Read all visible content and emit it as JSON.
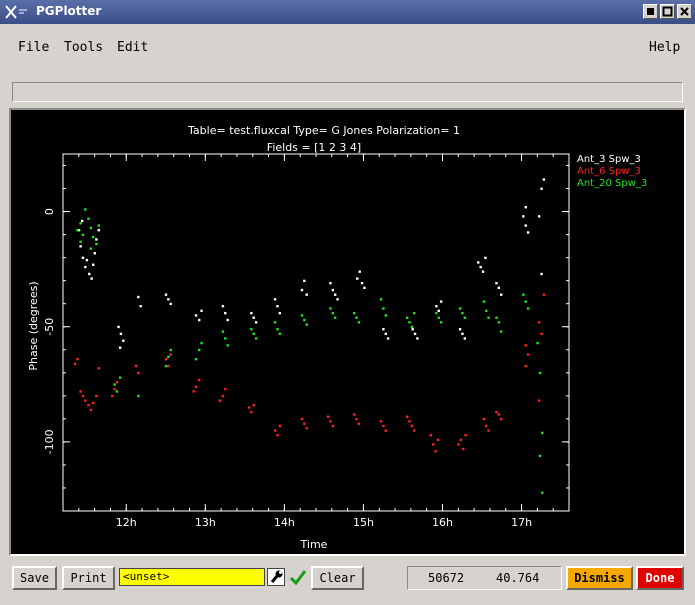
{
  "window": {
    "title": "PGPlotter"
  },
  "menu": {
    "file": "File",
    "tools": "Tools",
    "edit": "Edit",
    "help": "Help"
  },
  "bottom": {
    "save": "Save",
    "print": "Print",
    "entry_value": "<unset>",
    "clear": "Clear",
    "readout_x": "50672",
    "readout_y": "40.764",
    "dismiss": "Dismiss",
    "done": "Done"
  },
  "colors": {
    "background": "#000000",
    "series_1": "#ffffff",
    "series_2": "#ff2020",
    "series_3": "#20e020",
    "dismiss": "#f5a800",
    "done": "#e00000",
    "entry": "#ffff00"
  },
  "chart_data": {
    "type": "scatter",
    "title": "Table= test.fluxcal    Type= G Jones    Polarization= 1",
    "subtitle": "Fields = [1 2 3 4]",
    "xlabel": "Time",
    "ylabel": "Phase (degrees)",
    "xlim": [
      11.2,
      17.6
    ],
    "ylim": [
      -130,
      25
    ],
    "xticks": [
      {
        "value": 12,
        "label": "12h"
      },
      {
        "value": 13,
        "label": "13h"
      },
      {
        "value": 14,
        "label": "14h"
      },
      {
        "value": 15,
        "label": "15h"
      },
      {
        "value": 16,
        "label": "16h"
      },
      {
        "value": 17,
        "label": "17h"
      }
    ],
    "yticks": [
      {
        "value": 0,
        "label": "0"
      },
      {
        "value": -50,
        "label": "-50"
      },
      {
        "value": -100,
        "label": "-100"
      }
    ],
    "legend": "top-right",
    "series": [
      {
        "name": "Ant_3 Spw_3",
        "color": "#ffffff",
        "points": [
          [
            11.42,
            -15
          ],
          [
            11.45,
            -20
          ],
          [
            11.48,
            -24
          ],
          [
            11.5,
            -21
          ],
          [
            11.53,
            -27
          ],
          [
            11.56,
            -29
          ],
          [
            11.58,
            -23
          ],
          [
            11.6,
            -18
          ],
          [
            11.62,
            -12
          ],
          [
            11.65,
            -8
          ],
          [
            11.4,
            -8
          ],
          [
            11.44,
            -4
          ],
          [
            11.9,
            -50
          ],
          [
            11.93,
            -53
          ],
          [
            11.96,
            -56
          ],
          [
            11.92,
            -59
          ],
          [
            12.15,
            -37
          ],
          [
            12.18,
            -41
          ],
          [
            12.5,
            -36
          ],
          [
            12.53,
            -38
          ],
          [
            12.56,
            -40
          ],
          [
            12.88,
            -45
          ],
          [
            12.92,
            -47
          ],
          [
            12.95,
            -43
          ],
          [
            13.22,
            -41
          ],
          [
            13.25,
            -44
          ],
          [
            13.28,
            -47
          ],
          [
            13.58,
            -44
          ],
          [
            13.61,
            -46
          ],
          [
            13.64,
            -48
          ],
          [
            13.88,
            -38
          ],
          [
            13.91,
            -41
          ],
          [
            13.94,
            -44
          ],
          [
            14.22,
            -34
          ],
          [
            14.25,
            -30
          ],
          [
            14.28,
            -36
          ],
          [
            14.58,
            -31
          ],
          [
            14.61,
            -34
          ],
          [
            14.64,
            -36
          ],
          [
            14.67,
            -38
          ],
          [
            14.92,
            -29
          ],
          [
            14.95,
            -26
          ],
          [
            14.98,
            -31
          ],
          [
            15.01,
            -33
          ],
          [
            15.25,
            -51
          ],
          [
            15.28,
            -53
          ],
          [
            15.31,
            -55
          ],
          [
            15.62,
            -51
          ],
          [
            15.65,
            -53
          ],
          [
            15.68,
            -55
          ],
          [
            15.92,
            -41
          ],
          [
            15.95,
            -43
          ],
          [
            15.98,
            -39
          ],
          [
            16.22,
            -51
          ],
          [
            16.25,
            -53
          ],
          [
            16.28,
            -55
          ],
          [
            16.45,
            -22
          ],
          [
            16.48,
            -24
          ],
          [
            16.51,
            -26
          ],
          [
            16.54,
            -20
          ],
          [
            16.68,
            -31
          ],
          [
            16.71,
            -33
          ],
          [
            16.74,
            -36
          ],
          [
            17.02,
            -2
          ],
          [
            17.05,
            -6
          ],
          [
            17.08,
            -9
          ],
          [
            17.05,
            2
          ],
          [
            17.22,
            -2
          ],
          [
            17.25,
            10
          ],
          [
            17.28,
            14
          ],
          [
            17.25,
            -27
          ]
        ]
      },
      {
        "name": "Ant_6 Spw_3",
        "color": "#ff2020",
        "points": [
          [
            11.35,
            -66
          ],
          [
            11.38,
            -64
          ],
          [
            11.42,
            -78
          ],
          [
            11.45,
            -80
          ],
          [
            11.48,
            -82
          ],
          [
            11.52,
            -84
          ],
          [
            11.55,
            -86
          ],
          [
            11.58,
            -83
          ],
          [
            11.62,
            -80
          ],
          [
            11.65,
            -68
          ],
          [
            11.82,
            -80
          ],
          [
            11.85,
            -77
          ],
          [
            11.88,
            -74
          ],
          [
            12.12,
            -67
          ],
          [
            12.15,
            -70
          ],
          [
            12.5,
            -64
          ],
          [
            12.53,
            -67
          ],
          [
            12.56,
            -62
          ],
          [
            12.85,
            -78
          ],
          [
            12.88,
            -76
          ],
          [
            12.92,
            -73
          ],
          [
            13.18,
            -82
          ],
          [
            13.22,
            -80
          ],
          [
            13.25,
            -77
          ],
          [
            13.55,
            -85
          ],
          [
            13.58,
            -87
          ],
          [
            13.61,
            -84
          ],
          [
            13.88,
            -95
          ],
          [
            13.91,
            -97
          ],
          [
            13.94,
            -93
          ],
          [
            14.22,
            -90
          ],
          [
            14.25,
            -92
          ],
          [
            14.28,
            -94
          ],
          [
            14.55,
            -89
          ],
          [
            14.58,
            -91
          ],
          [
            14.61,
            -93
          ],
          [
            14.88,
            -88
          ],
          [
            14.91,
            -90
          ],
          [
            14.94,
            -92
          ],
          [
            15.22,
            -91
          ],
          [
            15.25,
            -93
          ],
          [
            15.28,
            -95
          ],
          [
            15.55,
            -89
          ],
          [
            15.58,
            -91
          ],
          [
            15.61,
            -93
          ],
          [
            15.64,
            -95
          ],
          [
            15.85,
            -97
          ],
          [
            15.88,
            -101
          ],
          [
            15.91,
            -104
          ],
          [
            15.94,
            -99
          ],
          [
            16.2,
            -101
          ],
          [
            16.23,
            -99
          ],
          [
            16.26,
            -103
          ],
          [
            16.29,
            -97
          ],
          [
            16.52,
            -90
          ],
          [
            16.55,
            -93
          ],
          [
            16.58,
            -95
          ],
          [
            16.68,
            -87
          ],
          [
            16.71,
            -88
          ],
          [
            16.74,
            -90
          ],
          [
            17.05,
            -58
          ],
          [
            17.08,
            -62
          ],
          [
            17.05,
            -67
          ],
          [
            17.22,
            -48
          ],
          [
            17.25,
            -53
          ],
          [
            17.28,
            -36
          ],
          [
            17.22,
            -82
          ]
        ]
      },
      {
        "name": "Ant_20 Spw_3",
        "color": "#20e020",
        "points": [
          [
            11.38,
            -8
          ],
          [
            11.42,
            -5
          ],
          [
            11.45,
            -10
          ],
          [
            11.48,
            1
          ],
          [
            11.52,
            -3
          ],
          [
            11.55,
            -7
          ],
          [
            11.58,
            -11
          ],
          [
            11.62,
            -14
          ],
          [
            11.65,
            -6
          ],
          [
            11.42,
            -13
          ],
          [
            11.55,
            -16
          ],
          [
            11.85,
            -75
          ],
          [
            11.88,
            -78
          ],
          [
            11.92,
            -72
          ],
          [
            12.15,
            -80
          ],
          [
            12.5,
            -67
          ],
          [
            12.53,
            -63
          ],
          [
            12.56,
            -60
          ],
          [
            12.88,
            -64
          ],
          [
            12.92,
            -60
          ],
          [
            12.95,
            -57
          ],
          [
            13.22,
            -52
          ],
          [
            13.25,
            -55
          ],
          [
            13.28,
            -58
          ],
          [
            13.58,
            -51
          ],
          [
            13.61,
            -53
          ],
          [
            13.64,
            -55
          ],
          [
            13.88,
            -48
          ],
          [
            13.91,
            -51
          ],
          [
            13.94,
            -53
          ],
          [
            14.22,
            -45
          ],
          [
            14.25,
            -47
          ],
          [
            14.28,
            -49
          ],
          [
            14.58,
            -42
          ],
          [
            14.61,
            -44
          ],
          [
            14.64,
            -46
          ],
          [
            14.88,
            -44
          ],
          [
            14.91,
            -46
          ],
          [
            14.94,
            -48
          ],
          [
            15.22,
            -38
          ],
          [
            15.25,
            -42
          ],
          [
            15.28,
            -45
          ],
          [
            15.55,
            -46
          ],
          [
            15.58,
            -48
          ],
          [
            15.61,
            -50
          ],
          [
            15.64,
            -44
          ],
          [
            15.92,
            -44
          ],
          [
            15.95,
            -46
          ],
          [
            15.98,
            -48
          ],
          [
            16.22,
            -42
          ],
          [
            16.25,
            -44
          ],
          [
            16.28,
            -46
          ],
          [
            16.52,
            -39
          ],
          [
            16.55,
            -43
          ],
          [
            16.58,
            -46
          ],
          [
            16.68,
            -46
          ],
          [
            16.71,
            -48
          ],
          [
            16.74,
            -52
          ],
          [
            17.02,
            -36
          ],
          [
            17.05,
            -39
          ],
          [
            17.08,
            -42
          ],
          [
            17.2,
            -57
          ],
          [
            17.23,
            -70
          ],
          [
            17.26,
            -122
          ],
          [
            17.23,
            -106
          ],
          [
            17.26,
            -96
          ]
        ]
      }
    ]
  }
}
